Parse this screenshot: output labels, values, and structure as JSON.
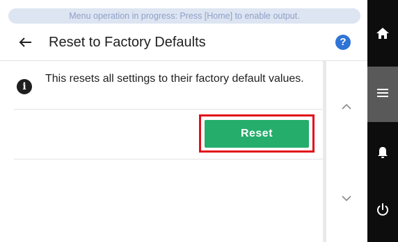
{
  "banner": {
    "text": "Menu operation in progress: Press [Home] to enable output."
  },
  "header": {
    "title": "Reset to Factory Defaults",
    "help_label": "?"
  },
  "info": {
    "icon_label": "i",
    "text": "This resets all settings to their factory default values."
  },
  "reset_button": {
    "label": "Reset",
    "highlight_color": "#e20d18",
    "color": "#25ad6c"
  },
  "icons": {
    "back": "arrow-left-icon",
    "help": "question-circle-icon",
    "info": "info-circle-icon",
    "scroll_up": "chevron-up-icon",
    "scroll_down": "chevron-down-icon",
    "home": "home-icon",
    "menu": "hamburger-menu-icon",
    "notifications": "bell-icon",
    "power": "power-icon"
  },
  "colors": {
    "accent_blue": "#2f73d6",
    "sidebar_bg": "#0d0d0d",
    "sidebar_active": "#595959"
  }
}
